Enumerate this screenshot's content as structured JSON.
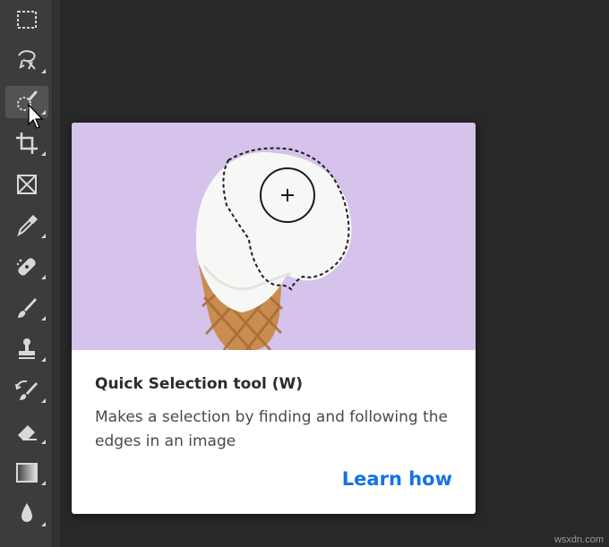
{
  "toolbar": {
    "tools": [
      {
        "icon": "marquee-icon"
      },
      {
        "icon": "lasso-icon"
      },
      {
        "icon": "quick-selection-icon",
        "active": true
      },
      {
        "icon": "crop-icon"
      },
      {
        "icon": "frame-icon"
      },
      {
        "icon": "eyedropper-icon"
      },
      {
        "icon": "healing-brush-icon"
      },
      {
        "icon": "brush-icon"
      },
      {
        "icon": "clone-stamp-icon"
      },
      {
        "icon": "history-brush-icon"
      },
      {
        "icon": "eraser-icon"
      },
      {
        "icon": "gradient-icon"
      },
      {
        "icon": "blur-icon"
      }
    ]
  },
  "tooltip": {
    "title": "Quick Selection tool (W)",
    "description": "Makes a selection by finding and following the edges in an image",
    "link_label": "Learn how",
    "link_color": "#1473e6",
    "preview_background": "#d6c3ec"
  },
  "watermark": "wsxdn.com",
  "colors": {
    "canvas": "#282828",
    "toolbar": "#3c3c3c",
    "icon": "#d8d8d8"
  }
}
